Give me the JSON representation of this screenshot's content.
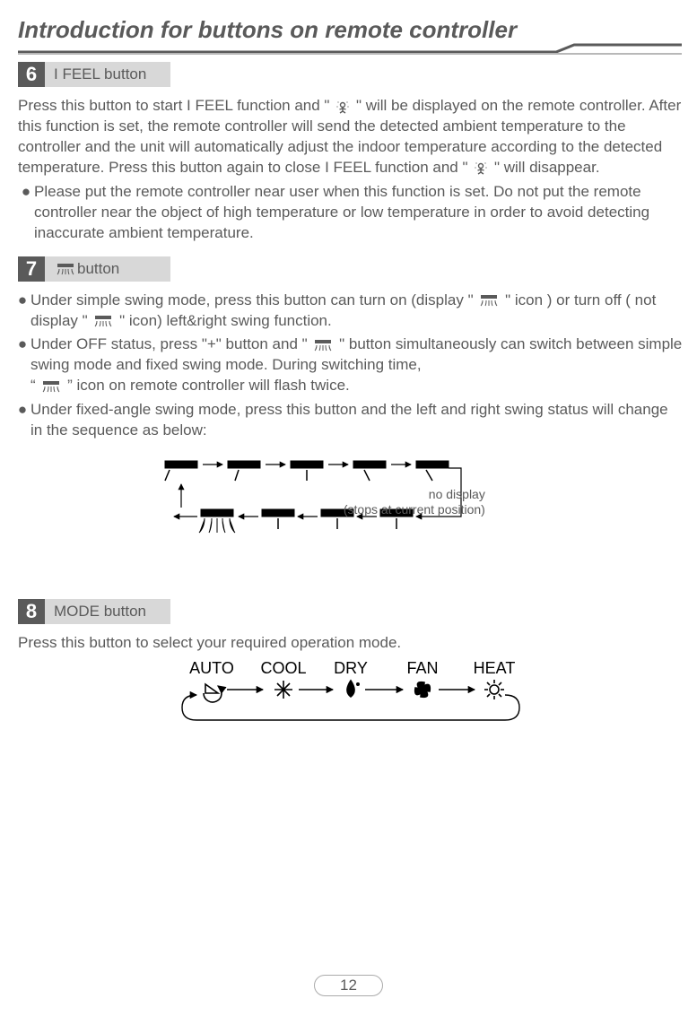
{
  "title": "Introduction for buttons on remote controller",
  "page_number": "12",
  "sections": {
    "s6": {
      "num": "6",
      "label": "I FEEL button",
      "para_a": "Press this button to start I FEEL function and \"",
      "para_b": "\" will be displayed on the remote controller. After this function is set, the remote controller will send the detected ambient temperature to the controller and the unit will automatically adjust the indoor temperature according to the detected temperature. Press this button again to close I FEEL function and \"",
      "para_c": "\" will disappear.",
      "bul1": "Please put the remote controller near user when this function is set. Do not put the remote controller near the object of high temperature or low temperature in order to avoid detecting inaccurate ambient temperature."
    },
    "s7": {
      "num": "7",
      "label": " button",
      "b1a": "Under simple swing mode, press this button can turn on (display \" ",
      "b1b": " \" icon ) or turn off ( not display \" ",
      "b1c": " \" icon) left&right swing function.",
      "b2a": "Under OFF status, press \"+\" button and \"",
      "b2b": "\" button simultaneously can switch between simple swing mode and fixed swing mode. During switching time,",
      "b2c": "“ ",
      "b2d": " ” icon on remote controller will flash twice.",
      "b3": "Under fixed-angle swing mode, press this button and the left and right swing status will change in the sequence as below:",
      "diag_label1": "no display",
      "diag_label2": "(stops at current position)"
    },
    "s8": {
      "num": "8",
      "label": "MODE button",
      "para": "Press this button to select your required operation mode.",
      "modes": {
        "auto": "AUTO",
        "cool": "COOL",
        "dry": "DRY",
        "fan": "FAN",
        "heat": "HEAT"
      }
    }
  }
}
